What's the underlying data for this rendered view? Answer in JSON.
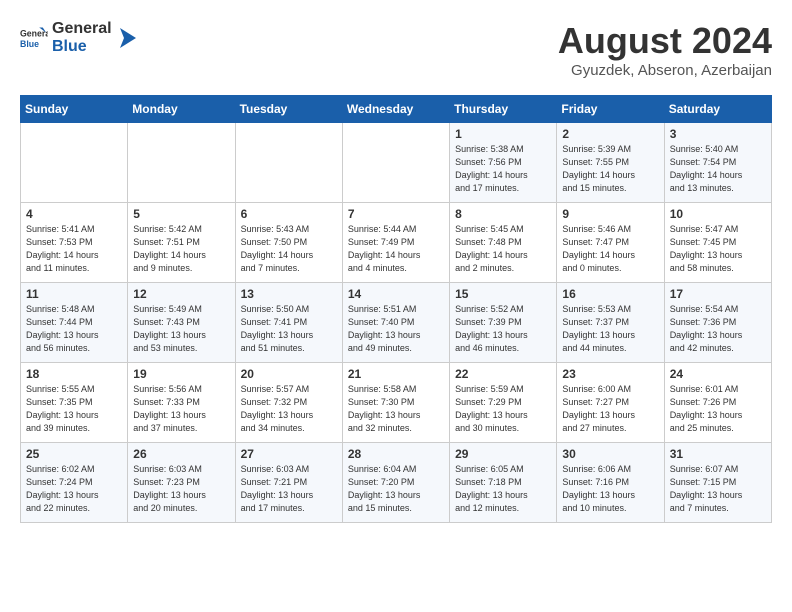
{
  "header": {
    "logo_general": "General",
    "logo_blue": "Blue",
    "month_year": "August 2024",
    "location": "Gyuzdek, Abseron, Azerbaijan"
  },
  "days_of_week": [
    "Sunday",
    "Monday",
    "Tuesday",
    "Wednesday",
    "Thursday",
    "Friday",
    "Saturday"
  ],
  "weeks": [
    [
      {
        "day": "",
        "info": ""
      },
      {
        "day": "",
        "info": ""
      },
      {
        "day": "",
        "info": ""
      },
      {
        "day": "",
        "info": ""
      },
      {
        "day": "1",
        "info": "Sunrise: 5:38 AM\nSunset: 7:56 PM\nDaylight: 14 hours\nand 17 minutes."
      },
      {
        "day": "2",
        "info": "Sunrise: 5:39 AM\nSunset: 7:55 PM\nDaylight: 14 hours\nand 15 minutes."
      },
      {
        "day": "3",
        "info": "Sunrise: 5:40 AM\nSunset: 7:54 PM\nDaylight: 14 hours\nand 13 minutes."
      }
    ],
    [
      {
        "day": "4",
        "info": "Sunrise: 5:41 AM\nSunset: 7:53 PM\nDaylight: 14 hours\nand 11 minutes."
      },
      {
        "day": "5",
        "info": "Sunrise: 5:42 AM\nSunset: 7:51 PM\nDaylight: 14 hours\nand 9 minutes."
      },
      {
        "day": "6",
        "info": "Sunrise: 5:43 AM\nSunset: 7:50 PM\nDaylight: 14 hours\nand 7 minutes."
      },
      {
        "day": "7",
        "info": "Sunrise: 5:44 AM\nSunset: 7:49 PM\nDaylight: 14 hours\nand 4 minutes."
      },
      {
        "day": "8",
        "info": "Sunrise: 5:45 AM\nSunset: 7:48 PM\nDaylight: 14 hours\nand 2 minutes."
      },
      {
        "day": "9",
        "info": "Sunrise: 5:46 AM\nSunset: 7:47 PM\nDaylight: 14 hours\nand 0 minutes."
      },
      {
        "day": "10",
        "info": "Sunrise: 5:47 AM\nSunset: 7:45 PM\nDaylight: 13 hours\nand 58 minutes."
      }
    ],
    [
      {
        "day": "11",
        "info": "Sunrise: 5:48 AM\nSunset: 7:44 PM\nDaylight: 13 hours\nand 56 minutes."
      },
      {
        "day": "12",
        "info": "Sunrise: 5:49 AM\nSunset: 7:43 PM\nDaylight: 13 hours\nand 53 minutes."
      },
      {
        "day": "13",
        "info": "Sunrise: 5:50 AM\nSunset: 7:41 PM\nDaylight: 13 hours\nand 51 minutes."
      },
      {
        "day": "14",
        "info": "Sunrise: 5:51 AM\nSunset: 7:40 PM\nDaylight: 13 hours\nand 49 minutes."
      },
      {
        "day": "15",
        "info": "Sunrise: 5:52 AM\nSunset: 7:39 PM\nDaylight: 13 hours\nand 46 minutes."
      },
      {
        "day": "16",
        "info": "Sunrise: 5:53 AM\nSunset: 7:37 PM\nDaylight: 13 hours\nand 44 minutes."
      },
      {
        "day": "17",
        "info": "Sunrise: 5:54 AM\nSunset: 7:36 PM\nDaylight: 13 hours\nand 42 minutes."
      }
    ],
    [
      {
        "day": "18",
        "info": "Sunrise: 5:55 AM\nSunset: 7:35 PM\nDaylight: 13 hours\nand 39 minutes."
      },
      {
        "day": "19",
        "info": "Sunrise: 5:56 AM\nSunset: 7:33 PM\nDaylight: 13 hours\nand 37 minutes."
      },
      {
        "day": "20",
        "info": "Sunrise: 5:57 AM\nSunset: 7:32 PM\nDaylight: 13 hours\nand 34 minutes."
      },
      {
        "day": "21",
        "info": "Sunrise: 5:58 AM\nSunset: 7:30 PM\nDaylight: 13 hours\nand 32 minutes."
      },
      {
        "day": "22",
        "info": "Sunrise: 5:59 AM\nSunset: 7:29 PM\nDaylight: 13 hours\nand 30 minutes."
      },
      {
        "day": "23",
        "info": "Sunrise: 6:00 AM\nSunset: 7:27 PM\nDaylight: 13 hours\nand 27 minutes."
      },
      {
        "day": "24",
        "info": "Sunrise: 6:01 AM\nSunset: 7:26 PM\nDaylight: 13 hours\nand 25 minutes."
      }
    ],
    [
      {
        "day": "25",
        "info": "Sunrise: 6:02 AM\nSunset: 7:24 PM\nDaylight: 13 hours\nand 22 minutes."
      },
      {
        "day": "26",
        "info": "Sunrise: 6:03 AM\nSunset: 7:23 PM\nDaylight: 13 hours\nand 20 minutes."
      },
      {
        "day": "27",
        "info": "Sunrise: 6:03 AM\nSunset: 7:21 PM\nDaylight: 13 hours\nand 17 minutes."
      },
      {
        "day": "28",
        "info": "Sunrise: 6:04 AM\nSunset: 7:20 PM\nDaylight: 13 hours\nand 15 minutes."
      },
      {
        "day": "29",
        "info": "Sunrise: 6:05 AM\nSunset: 7:18 PM\nDaylight: 13 hours\nand 12 minutes."
      },
      {
        "day": "30",
        "info": "Sunrise: 6:06 AM\nSunset: 7:16 PM\nDaylight: 13 hours\nand 10 minutes."
      },
      {
        "day": "31",
        "info": "Sunrise: 6:07 AM\nSunset: 7:15 PM\nDaylight: 13 hours\nand 7 minutes."
      }
    ]
  ]
}
